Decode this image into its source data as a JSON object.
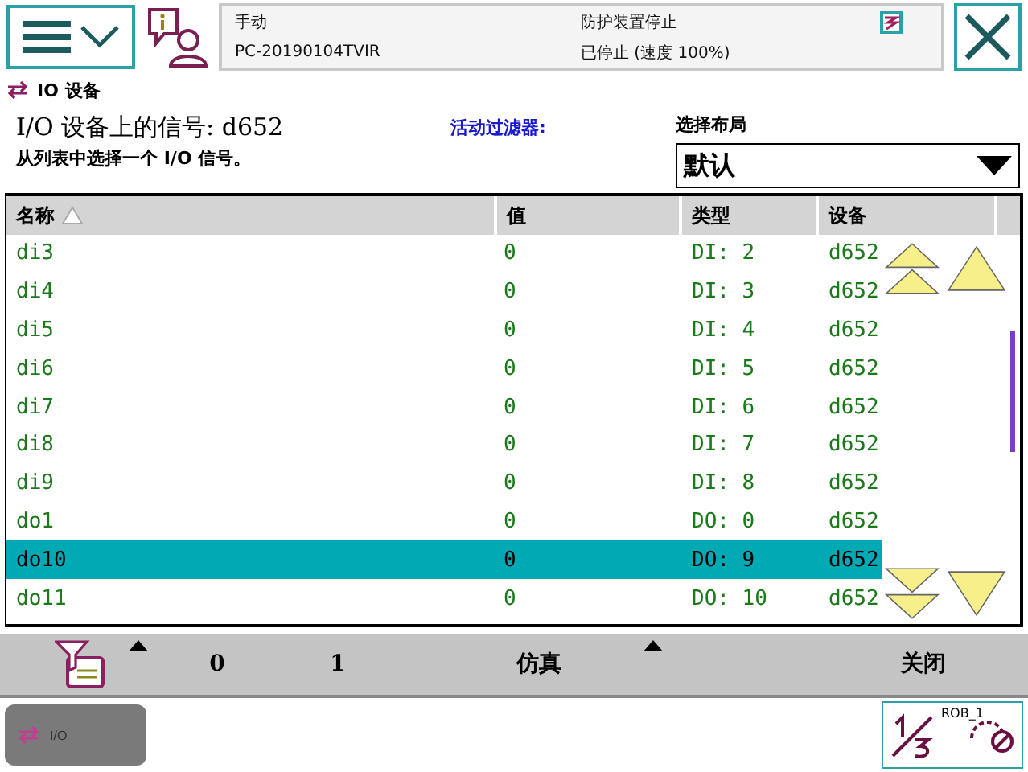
{
  "header": {
    "mode": "手动",
    "system": "PC-20190104TVIR",
    "safety": "防护装置停止",
    "run_state": "已停止 (速度 100%)"
  },
  "breadcrumb": "IO 设备",
  "title": "I/O 设备上的信号: d652",
  "instruction": "从列表中选择一个 I/O 信号。",
  "filter_label": "活动过滤器:",
  "layout_label": "选择布局",
  "layout_select": {
    "value": "默认"
  },
  "table": {
    "columns": [
      {
        "label": "名称",
        "sorted": true
      },
      {
        "label": "值",
        "sorted": false
      },
      {
        "label": "类型",
        "sorted": false
      },
      {
        "label": "设备",
        "sorted": false
      }
    ],
    "rows": [
      {
        "cells": [
          "di3",
          "0",
          "DI: 2",
          "d652"
        ],
        "selected": false
      },
      {
        "cells": [
          "di4",
          "0",
          "DI: 3",
          "d652"
        ],
        "selected": false
      },
      {
        "cells": [
          "di5",
          "0",
          "DI: 4",
          "d652"
        ],
        "selected": false
      },
      {
        "cells": [
          "di6",
          "0",
          "DI: 5",
          "d652"
        ],
        "selected": false
      },
      {
        "cells": [
          "di7",
          "0",
          "DI: 6",
          "d652"
        ],
        "selected": false
      },
      {
        "cells": [
          "di8",
          "0",
          "DI: 7",
          "d652"
        ],
        "selected": false
      },
      {
        "cells": [
          "di9",
          "0",
          "DI: 8",
          "d652"
        ],
        "selected": false
      },
      {
        "cells": [
          "do1",
          "0",
          "DO: 0",
          "d652"
        ],
        "selected": false
      },
      {
        "cells": [
          "do10",
          "0",
          "DO: 9",
          "d652"
        ],
        "selected": true
      },
      {
        "cells": [
          "do11",
          "0",
          "DO: 10",
          "d652"
        ],
        "selected": false
      }
    ]
  },
  "toolbar": {
    "filter_button": {
      "menu": true
    },
    "buttons": [
      {
        "label": "0",
        "menu": false
      },
      {
        "label": "1",
        "menu": false
      },
      {
        "label": "仿真",
        "menu": true
      },
      {
        "label": "关闭",
        "menu": false
      }
    ]
  },
  "taskbar": {
    "items": [
      {
        "label": "I/O",
        "selected": true
      }
    ]
  },
  "robot": {
    "label": "ROB_1"
  }
}
